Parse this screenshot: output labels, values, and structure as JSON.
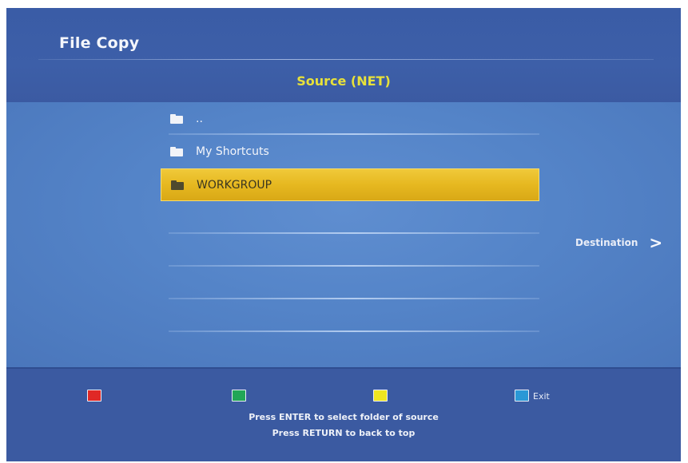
{
  "header": {
    "title": "File Copy",
    "source_title": "Source (NET)"
  },
  "list": {
    "items": [
      {
        "label": "..",
        "icon": "folder-icon",
        "selected": false
      },
      {
        "label": "My Shortcuts",
        "icon": "folder-icon",
        "selected": false
      },
      {
        "label": "WORKGROUP",
        "icon": "folder-icon",
        "selected": true
      }
    ]
  },
  "destination": {
    "label": "Destination",
    "arrow": ">"
  },
  "footer": {
    "keys": [
      {
        "color": "red",
        "hex": "#e02826",
        "label": ""
      },
      {
        "color": "green",
        "hex": "#21a656",
        "label": ""
      },
      {
        "color": "yellow",
        "hex": "#efe521",
        "label": ""
      },
      {
        "color": "blue",
        "hex": "#2a98d6",
        "label": "Exit"
      }
    ],
    "hint_1": "Press ENTER to select folder of source",
    "hint_2": "Press RETURN to back to top"
  },
  "colors": {
    "accent_title": "#e7e13a",
    "selection": "#e6b820",
    "background": "#3a5aa0"
  }
}
